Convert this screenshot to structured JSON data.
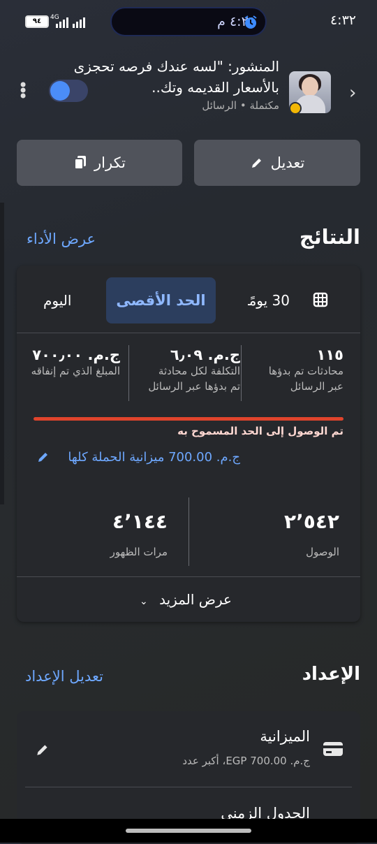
{
  "status_bar": {
    "time": "٤:٣٢",
    "pill_time": "٤:٢٨ م",
    "battery": "٩٤",
    "network": "4G"
  },
  "post": {
    "title": "المنشور: \"لسه عندك فرصه تحجزى بالأسعار القديمه وتك..",
    "subtitle": "مكتملة • الرسائل"
  },
  "actions": {
    "edit": "تعديل",
    "duplicate": "تكرار"
  },
  "results": {
    "heading": "النتائج",
    "view_performance": "عرض الأداء",
    "tabs": {
      "days30": "30 يومًا",
      "max": "الحد الأقصى",
      "today": "اليوم"
    },
    "metrics": {
      "conversations_value": "١١٥",
      "conversations_label_1": "محادثات تم بدؤها",
      "conversations_label_2": "عبر الرسائل",
      "cost_value": "ج.م. ٦٫٠٩",
      "cost_label_1": "التكلفة لكل محادثة",
      "cost_label_2": "تم بدؤها عبر الرسائل",
      "spent_value": "ج.م. ٧٠٠٫٠٠",
      "spent_label": "المبلغ الذي تم إنفاقه"
    },
    "limit_text": "تم الوصول إلى الحد المسموح به",
    "budget_link": "ج.م. 700.00 ميزانية الحملة كلها",
    "spend_progress": 1.0,
    "reach_value": "٢٬٥٤٢",
    "reach_label": "الوصول",
    "impressions_value": "٤٬١٤٤",
    "impressions_label": "مرات الظهور",
    "show_more": "عرض المزيد"
  },
  "setup": {
    "heading": "الإعداد",
    "edit_setup": "تعديل الإعداد",
    "budget_title": "الميزانية",
    "budget_sub": "ج.م. EGP 700.00، أكبر عدد",
    "schedule_title": "الجدول الزمني"
  },
  "colors": {
    "accent": "#6ea8ff",
    "limit_bar": "#e0442c",
    "toggle": "#4b8df8"
  }
}
